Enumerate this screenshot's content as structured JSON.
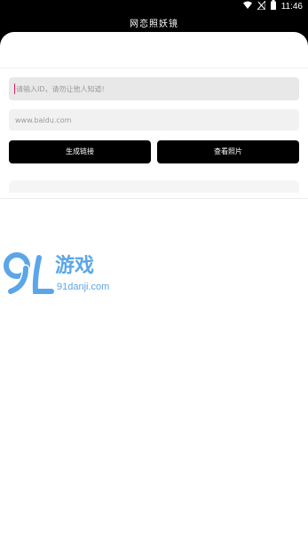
{
  "status_bar": {
    "time": "11:46",
    "icons": [
      "wifi-icon",
      "signal-off-icon",
      "battery-icon"
    ]
  },
  "app": {
    "title": "网恋照妖镜"
  },
  "form": {
    "id_input": {
      "placeholder": "请输入ID，请勿让他人知道!"
    },
    "url_input": {
      "placeholder": "www.baidu.com"
    },
    "buttons": {
      "generate_label": "生成链接",
      "view_label": "查看照片"
    }
  },
  "watermark": {
    "logo_text": "游戏",
    "site_text": "91danji.com"
  },
  "colors": {
    "status_bar": "#000000",
    "button_bg": "#000000",
    "input_bg": "#e8e8e8",
    "caret": "#e0245e",
    "watermark_blue": "#5aa6e8"
  }
}
